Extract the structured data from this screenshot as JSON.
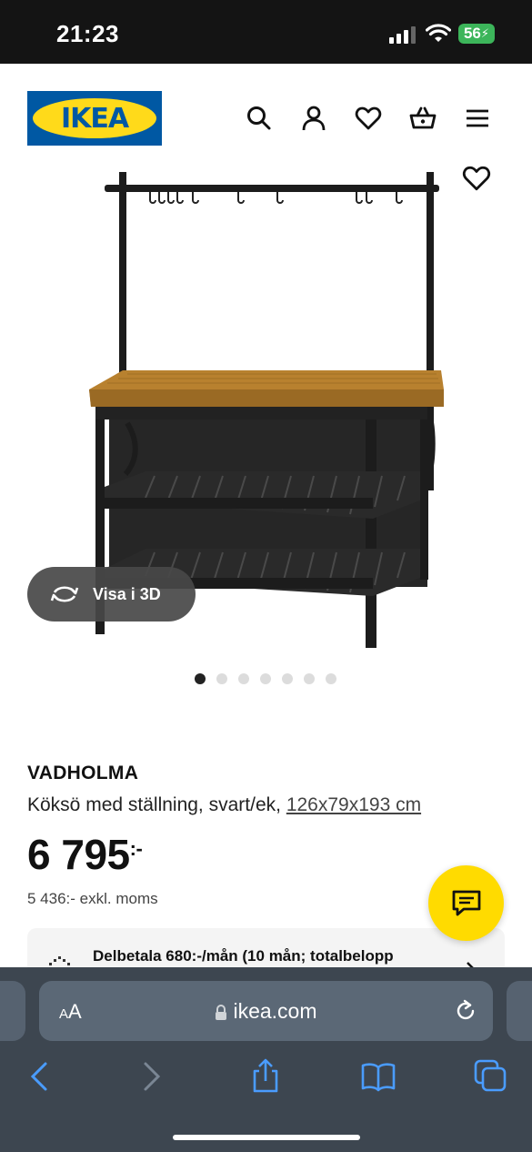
{
  "status_bar": {
    "time": "21:23",
    "battery": "56"
  },
  "header": {
    "logo_text": "IKEA",
    "icons": [
      "search-icon",
      "account-icon",
      "heart-icon",
      "basket-icon",
      "menu-icon"
    ]
  },
  "gallery": {
    "view_3d_label": "Visa i 3D",
    "dot_count": 7,
    "active_dot": 0
  },
  "product": {
    "name": "VADHOLMA",
    "description": "Köksö med ställning, svart/ek,",
    "dimensions": "126x79x193 cm",
    "price_main": "6 795",
    "price_suffix": ":-",
    "price_excl_vat": "5 436:- exkl. moms"
  },
  "financing": {
    "text": "Delbetala 680:-/mån (10 mån; totalbelopp"
  },
  "browser": {
    "aa_label_small": "A",
    "aa_label_large": "A",
    "url": "ikea.com"
  },
  "colors": {
    "ikea_blue": "#0058a3",
    "ikea_yellow": "#ffda1a",
    "chat_yellow": "#ffdb00",
    "safari_bar": "#3d4650"
  }
}
